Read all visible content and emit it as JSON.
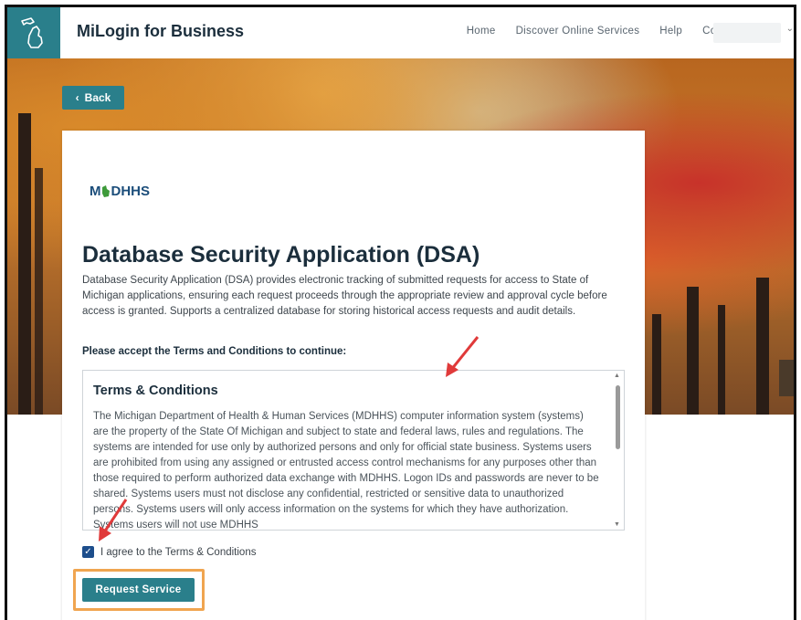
{
  "header": {
    "app_title": "MiLogin for Business",
    "nav": [
      "Home",
      "Discover Online Services",
      "Help",
      "Contact Us"
    ]
  },
  "back_label": "Back",
  "card": {
    "logo_text": "MDHHS",
    "title": "Database Security Application (DSA)",
    "description": "Database Security Application (DSA) provides electronic tracking of submitted requests for access to State of Michigan applications, ensuring each request proceeds through the appropriate review and approval cycle before access is granted. Supports a centralized database for storing historical access requests and audit details.",
    "accept_prompt": "Please accept the Terms and Conditions to continue:",
    "terms_title": "Terms & Conditions",
    "terms_body": "The Michigan Department of Health & Human Services (MDHHS) computer information system (systems) are the property of the State Of Michigan and subject to state and federal laws, rules and regulations. The systems are intended for use only by authorized persons and only for official state business. Systems users are prohibited from using any assigned or entrusted access control mechanisms for any purposes other than those required to perform authorized data exchange with MDHHS. Logon IDs and passwords are never to be shared. Systems users must not disclose any confidential, restricted or sensitive data to unauthorized persons. Systems users will only access information on the systems for which they have authorization. Systems users will not use MDHHS",
    "agree_label": "I agree to the Terms & Conditions",
    "agree_checked": true,
    "request_button": "Request Service"
  },
  "colors": {
    "brand_teal": "#2a7f8b",
    "highlight_orange": "#f0a550",
    "annotation_red": "#e03a3a"
  }
}
